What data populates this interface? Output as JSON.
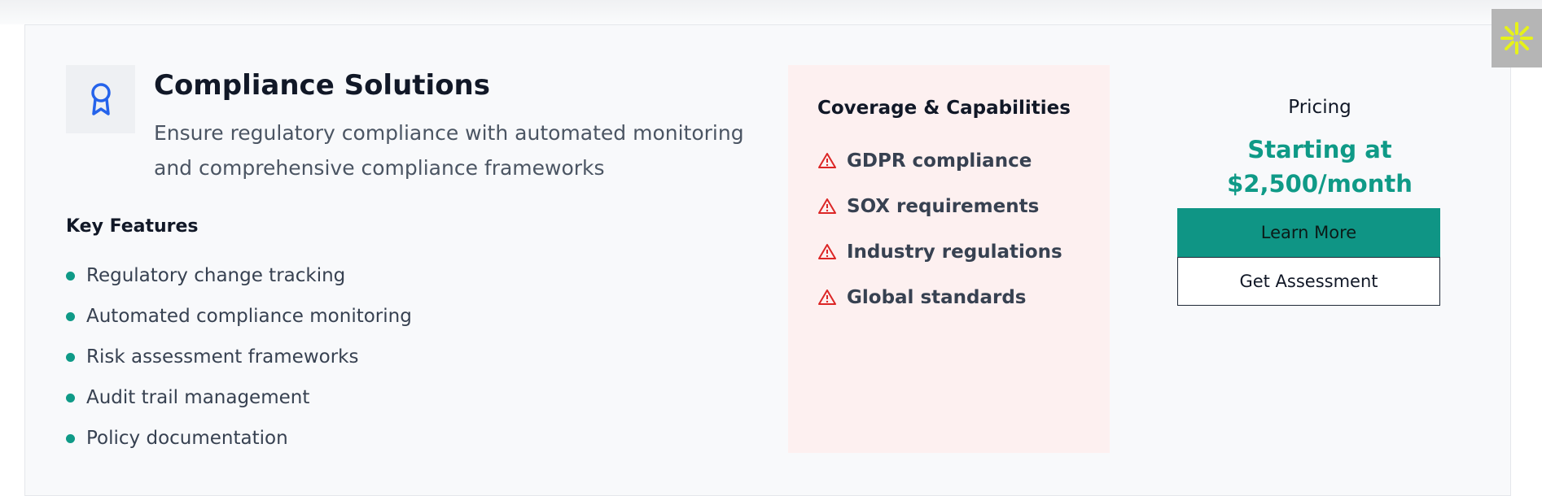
{
  "product": {
    "title": "Compliance Solutions",
    "description": "Ensure regulatory compliance with automated monitoring and comprehensive compliance frameworks",
    "icon": "award-ribbon-icon"
  },
  "features": {
    "heading": "Key Features",
    "items": [
      {
        "label": "Regulatory change tracking"
      },
      {
        "label": "Automated compliance monitoring"
      },
      {
        "label": "Risk assessment frameworks"
      },
      {
        "label": "Audit trail management"
      },
      {
        "label": "Policy documentation"
      }
    ]
  },
  "coverage": {
    "heading": "Coverage & Capabilities",
    "items": [
      {
        "label": "GDPR compliance",
        "icon": "warning-triangle-icon"
      },
      {
        "label": "SOX requirements",
        "icon": "warning-triangle-icon"
      },
      {
        "label": "Industry regulations",
        "icon": "warning-triangle-icon"
      },
      {
        "label": "Global standards",
        "icon": "warning-triangle-icon"
      }
    ]
  },
  "pricing": {
    "label": "Pricing",
    "price_line1": "Starting at",
    "price_line2": "$2,500/month",
    "learn_more_label": "Learn More",
    "get_assessment_label": "Get Assessment"
  },
  "colors": {
    "accent": "#0f9a87",
    "warning": "#dc2626",
    "icon_blue": "#2563eb",
    "coverage_bg": "#fdf0f0",
    "widget_yellow": "#e6f21a"
  }
}
